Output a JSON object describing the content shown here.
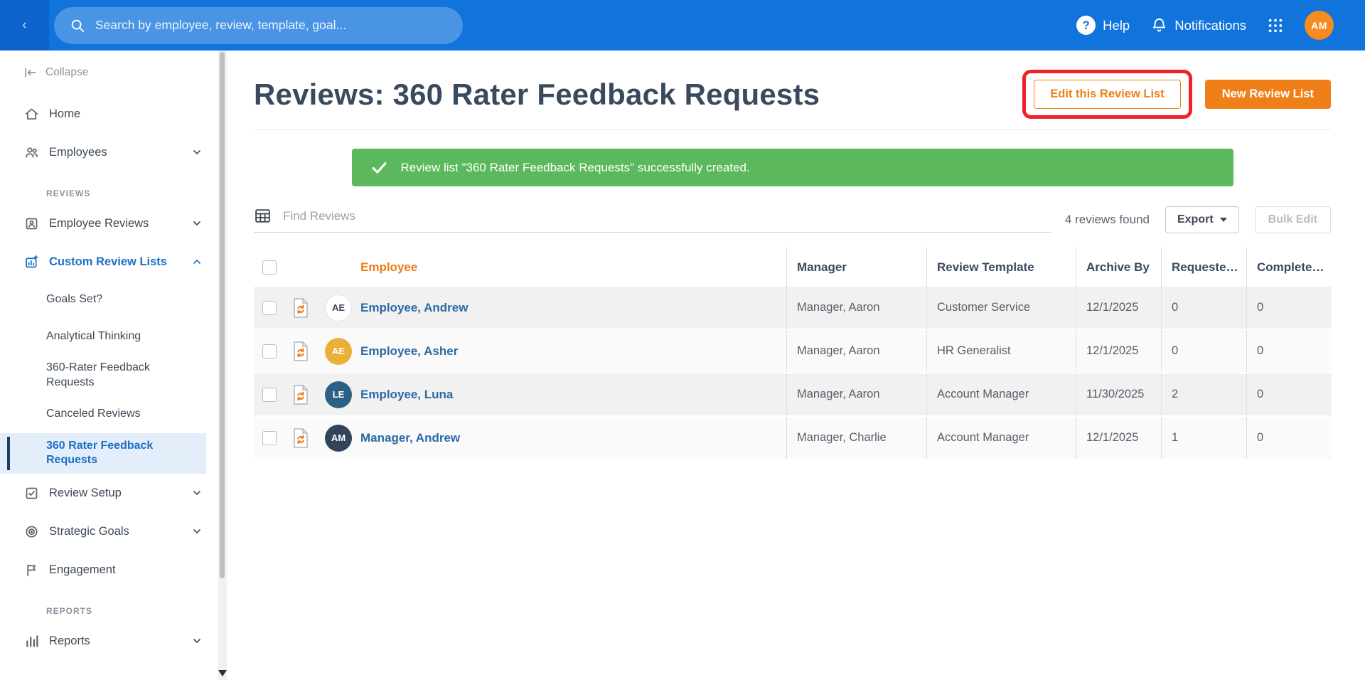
{
  "topbar": {
    "search_placeholder": "Search by employee, review, template, goal...",
    "help_label": "Help",
    "notifications_label": "Notifications",
    "avatar_initials": "AM"
  },
  "sidebar": {
    "collapse_label": "Collapse",
    "home": "Home",
    "employees": "Employees",
    "reviews_section": "REVIEWS",
    "employee_reviews": "Employee Reviews",
    "custom_review_lists": "Custom Review Lists",
    "sub_items": [
      "Goals Set?",
      "Analytical Thinking",
      "360-Rater Feedback Requests",
      "Canceled Reviews",
      "360 Rater Feedback Requests"
    ],
    "review_setup": "Review Setup",
    "strategic_goals": "Strategic Goals",
    "engagement": "Engagement",
    "reports_section": "REPORTS",
    "reports": "Reports"
  },
  "main": {
    "page_title": "Reviews: 360 Rater Feedback Requests",
    "buttons": {
      "edit_list": "Edit this Review List",
      "new_list": "New Review List"
    },
    "banner_text": "Review list \"360 Rater Feedback Requests\" successfully created.",
    "toolbar": {
      "find_placeholder": "Find Reviews",
      "count": "4 reviews found",
      "export_label": "Export",
      "bulk_edit_label": "Bulk Edit"
    },
    "table": {
      "headers": {
        "employee": "Employee",
        "manager": "Manager",
        "template": "Review Template",
        "archive_by": "Archive By",
        "requested": "Requeste…",
        "completed": "Complete…"
      },
      "rows": [
        {
          "initials": "AE",
          "avatar_bg": "#ffffff",
          "name": "Employee, Andrew",
          "manager": "Manager, Aaron",
          "template": "Customer Service",
          "archive_by": "12/1/2025",
          "requested": "0",
          "completed": "0"
        },
        {
          "initials": "AE",
          "avatar_bg": "#eab038",
          "name": "Employee, Asher",
          "manager": "Manager, Aaron",
          "template": "HR Generalist",
          "archive_by": "12/1/2025",
          "requested": "0",
          "completed": "0"
        },
        {
          "initials": "LE",
          "avatar_bg": "#2c6186",
          "name": "Employee, Luna",
          "manager": "Manager, Aaron",
          "template": "Account Manager",
          "archive_by": "11/30/2025",
          "requested": "2",
          "completed": "0"
        },
        {
          "initials": "AM",
          "avatar_bg": "#31445a",
          "name": "Manager, Andrew",
          "manager": "Manager, Charlie",
          "template": "Account Manager",
          "archive_by": "12/1/2025",
          "requested": "1",
          "completed": "0"
        }
      ]
    }
  },
  "colors": {
    "topbar_blue": "#1173dc",
    "accent_orange": "#ef8018",
    "success_green": "#5cb85c",
    "annotation_red": "#ee2226",
    "link_blue": "#2a6aa5",
    "active_nav_blue": "#1f6fc4"
  }
}
